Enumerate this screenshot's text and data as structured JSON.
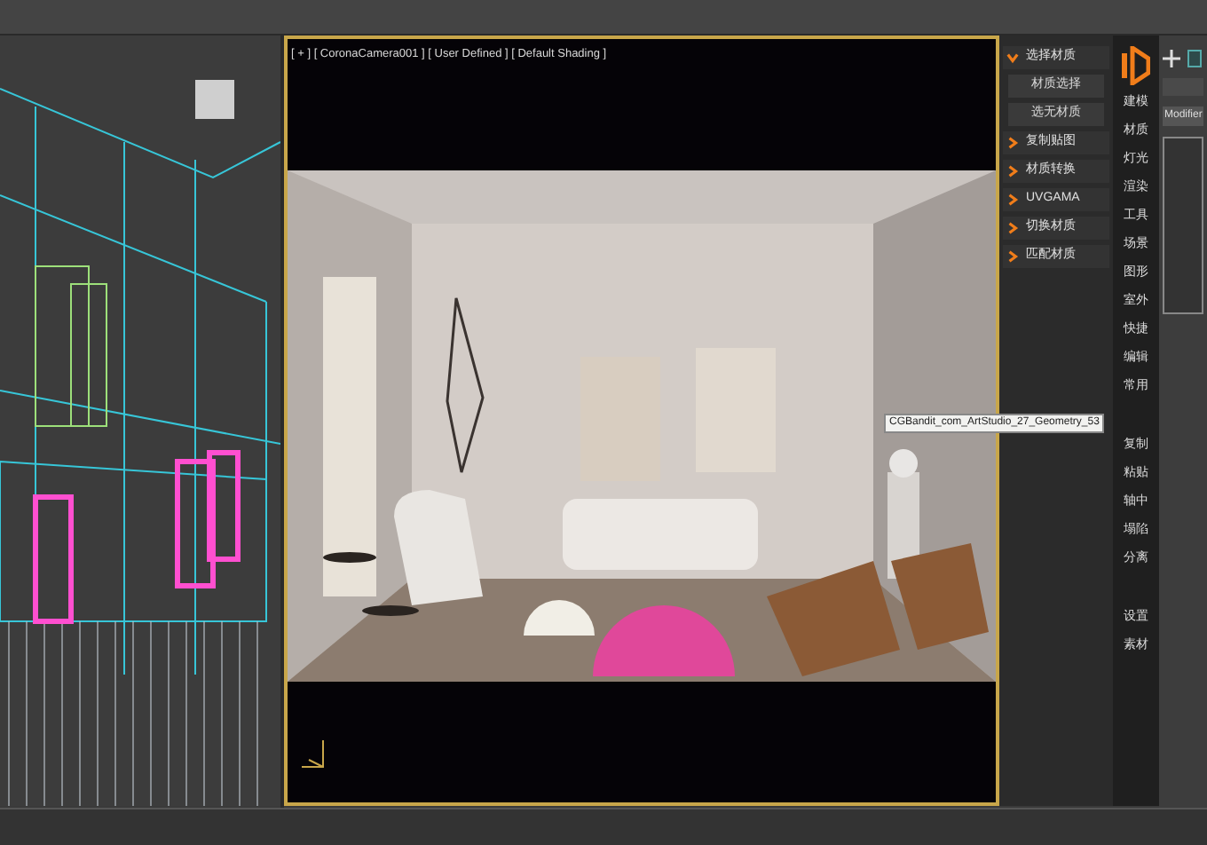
{
  "viewport": {
    "label": "[ + ] [ CoronaCamera001 ] [ User Defined ] [ Default Shading ]",
    "tooltip": "CGBandit_com_ArtStudio_27_Geometry_53"
  },
  "material_menu": [
    {
      "label": "选择材质",
      "expanded": true,
      "children": [
        {
          "label": "材质选择"
        },
        {
          "label": "选无材质"
        }
      ]
    },
    {
      "label": "复制贴图",
      "expanded": false
    },
    {
      "label": "材质转换",
      "expanded": false
    },
    {
      "label": "UVGAMA",
      "expanded": false
    },
    {
      "label": "切换材质",
      "expanded": false
    },
    {
      "label": "匹配材质",
      "expanded": false
    }
  ],
  "sidebar": {
    "groups": [
      [
        "建模",
        "材质",
        "灯光",
        "渲染",
        "工具",
        "场景",
        "图形",
        "室外",
        "快捷",
        "编辑",
        "常用"
      ],
      [
        "复制",
        "粘贴",
        "轴中",
        "塌陷",
        "分离"
      ],
      [
        "设置",
        "素材"
      ]
    ]
  },
  "command_panel": {
    "modifier_list": "Modifier"
  }
}
